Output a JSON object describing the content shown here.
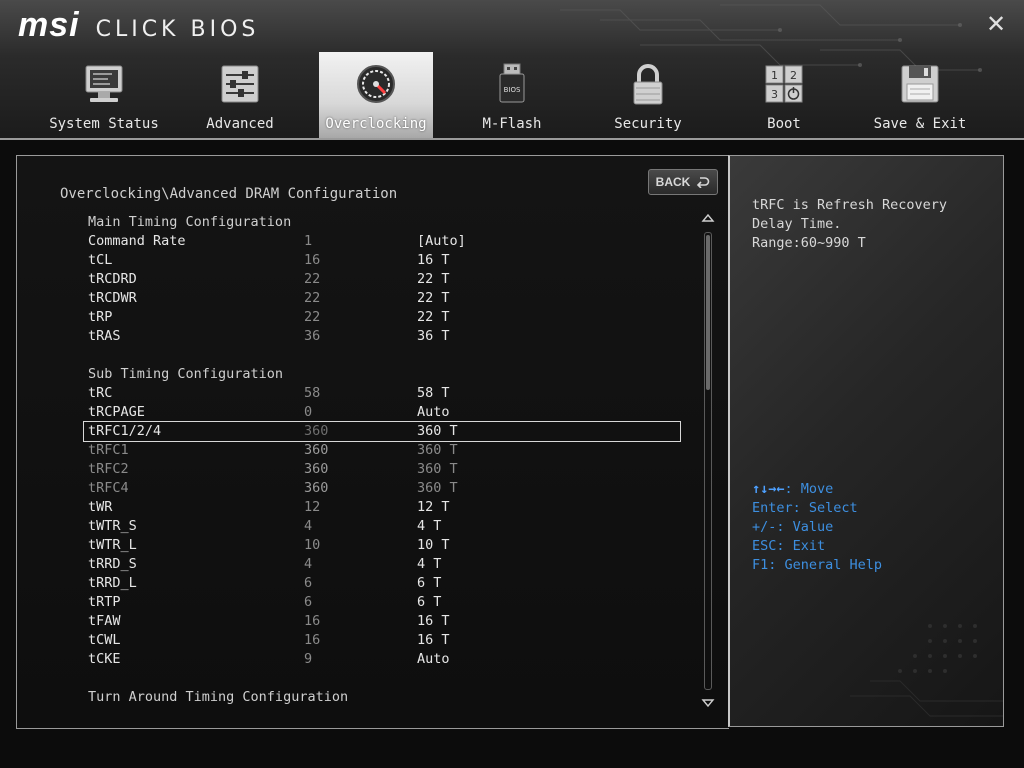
{
  "app": {
    "logo": "msi",
    "title": "CLICK BIOS",
    "close_icon": "close-icon"
  },
  "tabs": [
    {
      "label": "System Status",
      "icon": "monitor-icon",
      "active": false
    },
    {
      "label": "Advanced",
      "icon": "sliders-icon",
      "active": false
    },
    {
      "label": "Overclocking",
      "icon": "gauge-icon",
      "active": true
    },
    {
      "label": "M-Flash",
      "icon": "usb-flash-icon",
      "active": false
    },
    {
      "label": "Security",
      "icon": "lock-icon",
      "active": false
    },
    {
      "label": "Boot",
      "icon": "boot-order-icon",
      "active": false
    },
    {
      "label": "Save & Exit",
      "icon": "floppy-icon",
      "active": false
    }
  ],
  "main": {
    "breadcrumb": "Overclocking\\Advanced DRAM Configuration",
    "back_label": "BACK",
    "rows": [
      {
        "type": "section",
        "name": "Main Timing Configuration"
      },
      {
        "type": "item",
        "name": "Command Rate",
        "current": "1",
        "value": "[Auto]"
      },
      {
        "type": "item",
        "name": "tCL",
        "current": "16",
        "value": "16 T"
      },
      {
        "type": "item",
        "name": "tRCDRD",
        "current": "22",
        "value": "22 T"
      },
      {
        "type": "item",
        "name": "tRCDWR",
        "current": "22",
        "value": "22 T"
      },
      {
        "type": "item",
        "name": "tRP",
        "current": "22",
        "value": "22 T"
      },
      {
        "type": "item",
        "name": "tRAS",
        "current": "36",
        "value": "36 T"
      },
      {
        "type": "spacer"
      },
      {
        "type": "section",
        "name": "Sub Timing Configuration"
      },
      {
        "type": "item",
        "name": "tRC",
        "current": "58",
        "value": "58 T"
      },
      {
        "type": "item",
        "name": "tRCPAGE",
        "current": "0",
        "value": "Auto"
      },
      {
        "type": "selected",
        "name": "tRFC1/2/4",
        "current": "360",
        "value": "360 T"
      },
      {
        "type": "disabled",
        "name": "tRFC1",
        "current": "360",
        "value": "360 T"
      },
      {
        "type": "disabled",
        "name": "tRFC2",
        "current": "360",
        "value": "360 T"
      },
      {
        "type": "disabled",
        "name": "tRFC4",
        "current": "360",
        "value": "360 T"
      },
      {
        "type": "item",
        "name": "tWR",
        "current": "12",
        "value": "12 T"
      },
      {
        "type": "item",
        "name": "tWTR_S",
        "current": "4",
        "value": "4 T"
      },
      {
        "type": "item",
        "name": "tWTR_L",
        "current": "10",
        "value": "10 T"
      },
      {
        "type": "item",
        "name": "tRRD_S",
        "current": "4",
        "value": "4 T"
      },
      {
        "type": "item",
        "name": "tRRD_L",
        "current": "6",
        "value": "6 T"
      },
      {
        "type": "item",
        "name": "tRTP",
        "current": "6",
        "value": "6 T"
      },
      {
        "type": "item",
        "name": "tFAW",
        "current": "16",
        "value": "16 T"
      },
      {
        "type": "item",
        "name": "tCWL",
        "current": "16",
        "value": "16 T"
      },
      {
        "type": "item",
        "name": "tCKE",
        "current": "9",
        "value": "Auto"
      },
      {
        "type": "spacer"
      },
      {
        "type": "section",
        "name": "Turn Around Timing Configuration"
      }
    ]
  },
  "help": {
    "text": "tRFC is Refresh Recovery\nDelay Time.\nRange:60~990 T",
    "keys": {
      "move_symbol": "↑↓→←",
      "move": ": Move",
      "select": "Enter: Select",
      "value": "+/-: Value",
      "exit": "ESC: Exit",
      "general_help": "F1: General Help"
    }
  },
  "colors": {
    "accent_blue": "#3d8fe0",
    "active_tab": "#e6e6e6",
    "disabled_text": "#8a8a8a"
  }
}
